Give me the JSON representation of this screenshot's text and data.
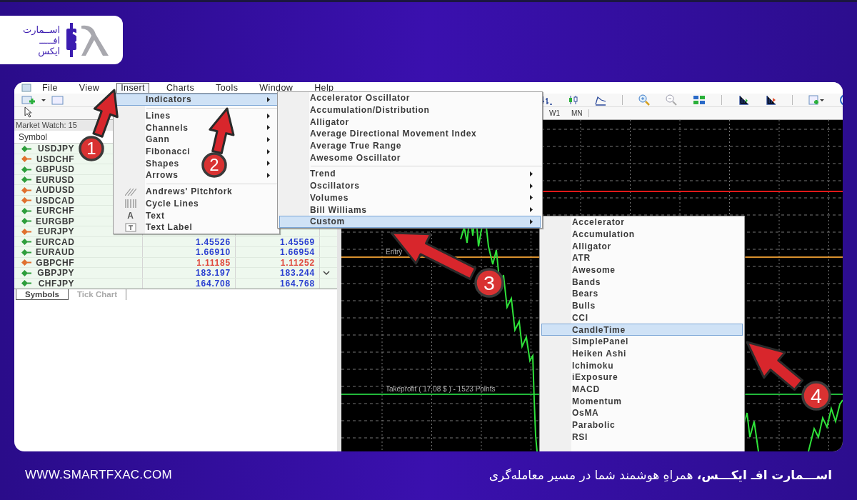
{
  "logo": {
    "lines": [
      "اســمارت",
      "افـــــ",
      "ایکس"
    ]
  },
  "menubar": [
    {
      "label": "File",
      "selected": false
    },
    {
      "label": "View",
      "selected": false
    },
    {
      "label": "Insert",
      "selected": true
    },
    {
      "label": "Charts",
      "selected": false
    },
    {
      "label": "Tools",
      "selected": false
    },
    {
      "label": "Window",
      "selected": false
    },
    {
      "label": "Help",
      "selected": false
    }
  ],
  "timeframes": [
    "W1",
    "MN"
  ],
  "market_watch": {
    "title": "Market Watch: 15",
    "columns": [
      "Symbol"
    ],
    "rows": [
      {
        "symbol": "USDJPY",
        "color": "#2e9e3c"
      },
      {
        "symbol": "USDCHF",
        "color": "#e0702e"
      },
      {
        "symbol": "GBPUSD",
        "color": "#2e9e3c"
      },
      {
        "symbol": "EURUSD",
        "color": "#2e9e3c"
      },
      {
        "symbol": "AUDUSD",
        "color": "#e0702e"
      },
      {
        "symbol": "USDCAD",
        "color": "#e0702e"
      },
      {
        "symbol": "EURCHF",
        "color": "#2e9e3c"
      },
      {
        "symbol": "EURGBP",
        "color": "#2e9e3c"
      },
      {
        "symbol": "EURJPY",
        "color": "#e0702e"
      },
      {
        "symbol": "EURCAD",
        "color": "#2e9e3c",
        "bid": "1.45526",
        "ask": "1.45569",
        "falling": false
      },
      {
        "symbol": "EURAUD",
        "color": "#2e9e3c",
        "bid": "1.66910",
        "ask": "1.66954",
        "falling": false
      },
      {
        "symbol": "GBPCHF",
        "color": "#e0702e",
        "bid": "1.11185",
        "ask": "1.11252",
        "falling": true
      },
      {
        "symbol": "GBPJPY",
        "color": "#2e9e3c",
        "bid": "183.197",
        "ask": "183.244",
        "falling": false
      },
      {
        "symbol": "CHFJPY",
        "color": "#2e9e3c",
        "bid": "164.708",
        "ask": "164.768",
        "falling": false
      }
    ],
    "tabs": [
      {
        "label": "Symbols",
        "selected": true
      },
      {
        "label": "Tick Chart",
        "selected": false
      }
    ]
  },
  "chart": {
    "lines": [
      {
        "color": "#e01818"
      },
      {
        "color": "#d8902e",
        "label": "Entry"
      },
      {
        "color": "#22b83a",
        "label": "Takeprofit ( 17.08 $ ) - 1523 Points"
      }
    ]
  },
  "insert_menu": {
    "items": [
      {
        "kind": "item",
        "label": "Indicators",
        "submenu": true,
        "selected": true
      },
      {
        "kind": "separator"
      },
      {
        "kind": "item",
        "label": "Lines",
        "submenu": true,
        "selected": false
      },
      {
        "kind": "item",
        "label": "Channels",
        "submenu": true,
        "selected": false
      },
      {
        "kind": "item",
        "label": "Gann",
        "submenu": true,
        "selected": false
      },
      {
        "kind": "item",
        "label": "Fibonacci",
        "submenu": true,
        "selected": false
      },
      {
        "kind": "item",
        "label": "Shapes",
        "submenu": true,
        "selected": false
      },
      {
        "kind": "item",
        "label": "Arrows",
        "submenu": true,
        "selected": false
      },
      {
        "kind": "separator"
      },
      {
        "kind": "tool",
        "label": "Andrews' Pitchfork",
        "submenu": false,
        "selected": false
      },
      {
        "kind": "tool",
        "label": "Cycle Lines",
        "submenu": false,
        "selected": false
      },
      {
        "kind": "tool",
        "label": "Text",
        "submenu": false,
        "selected": false,
        "glyph": "A"
      },
      {
        "kind": "tool",
        "label": "Text Label",
        "submenu": false,
        "selected": false
      }
    ]
  },
  "indicators_menu": {
    "items": [
      {
        "kind": "item",
        "label": "Accelerator Oscillator",
        "submenu": false,
        "selected": false
      },
      {
        "kind": "item",
        "label": "Accumulation/Distribution",
        "submenu": false,
        "selected": false
      },
      {
        "kind": "item",
        "label": "Alligator",
        "submenu": false,
        "selected": false
      },
      {
        "kind": "item",
        "label": "Average Directional Movement Index",
        "submenu": false,
        "selected": false
      },
      {
        "kind": "item",
        "label": "Average True Range",
        "submenu": false,
        "selected": false
      },
      {
        "kind": "item",
        "label": "Awesome Oscillator",
        "submenu": false,
        "selected": false
      },
      {
        "kind": "separator"
      },
      {
        "kind": "item",
        "label": "Trend",
        "submenu": true,
        "selected": false
      },
      {
        "kind": "item",
        "label": "Oscillators",
        "submenu": true,
        "selected": false
      },
      {
        "kind": "item",
        "label": "Volumes",
        "submenu": true,
        "selected": false
      },
      {
        "kind": "item",
        "label": "Bill Williams",
        "submenu": true,
        "selected": false
      },
      {
        "kind": "item",
        "label": "Custom",
        "submenu": true,
        "selected": true
      }
    ]
  },
  "custom_menu": {
    "items": [
      {
        "kind": "item",
        "label": "Accelerator",
        "submenu": false,
        "selected": false
      },
      {
        "kind": "item",
        "label": "Accumulation",
        "submenu": false,
        "selected": false
      },
      {
        "kind": "item",
        "label": "Alligator",
        "submenu": false,
        "selected": false
      },
      {
        "kind": "item",
        "label": "ATR",
        "submenu": false,
        "selected": false
      },
      {
        "kind": "item",
        "label": "Awesome",
        "submenu": false,
        "selected": false
      },
      {
        "kind": "item",
        "label": "Bands",
        "submenu": false,
        "selected": false
      },
      {
        "kind": "item",
        "label": "Bears",
        "submenu": false,
        "selected": false
      },
      {
        "kind": "item",
        "label": "Bulls",
        "submenu": false,
        "selected": false
      },
      {
        "kind": "item",
        "label": "CCI",
        "submenu": false,
        "selected": false
      },
      {
        "kind": "item",
        "label": "CandleTime",
        "submenu": false,
        "selected": true
      },
      {
        "kind": "item",
        "label": "SimplePanel",
        "submenu": false,
        "selected": false
      },
      {
        "kind": "item",
        "label": "Heiken Ashi",
        "submenu": false,
        "selected": false
      },
      {
        "kind": "item",
        "label": "Ichimoku",
        "submenu": false,
        "selected": false
      },
      {
        "kind": "item",
        "label": "iExposure",
        "submenu": false,
        "selected": false
      },
      {
        "kind": "item",
        "label": "MACD",
        "submenu": false,
        "selected": false
      },
      {
        "kind": "item",
        "label": "Momentum",
        "submenu": false,
        "selected": false
      },
      {
        "kind": "item",
        "label": "OsMA",
        "submenu": false,
        "selected": false
      },
      {
        "kind": "item",
        "label": "Parabolic",
        "submenu": false,
        "selected": false
      },
      {
        "kind": "item",
        "label": "RSI",
        "submenu": false,
        "selected": false
      }
    ]
  },
  "annotations": [
    {
      "number": "1"
    },
    {
      "number": "2"
    },
    {
      "number": "3"
    },
    {
      "number": "4"
    }
  ],
  "footer": {
    "website": "WWW.SMARTFXAC.COM",
    "slogan": "**اســـمارت افـ ایکـــس،** همراهِ هوشمند شما در مسیر معامله‌گری"
  }
}
